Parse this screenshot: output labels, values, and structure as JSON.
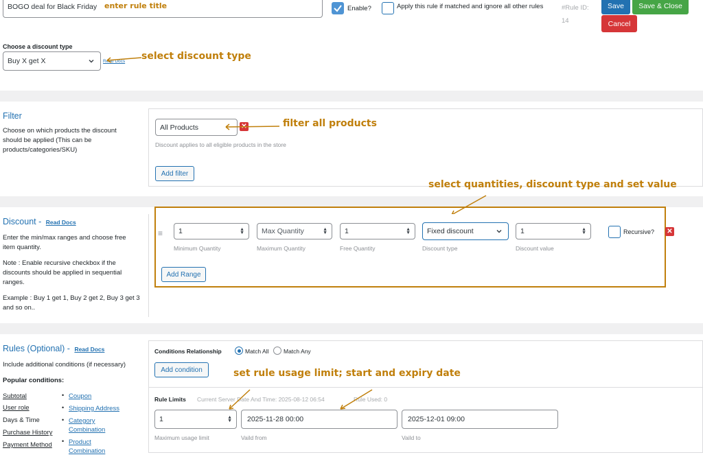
{
  "header": {
    "rule_title_value": "BOGO deal for Black Friday",
    "enable_label": "Enable?",
    "apply_rule_label": "Apply this rule if matched and ignore all other rules",
    "rule_id_label": "#Rule ID:",
    "rule_id_value": "14",
    "save_label": "Save",
    "save_close_label": "Save & Close",
    "cancel_label": "Cancel"
  },
  "discount_type": {
    "label": "Choose a discount type",
    "selected": "Buy X get X",
    "read_docs": "Read Docs"
  },
  "filter": {
    "title": "Filter",
    "description": "Choose on which products the discount should be applied (This can be products/categories/SKU)",
    "selected": "All Products",
    "hint": "Discount applies to all eligible products in the store",
    "add_filter_label": "Add filter"
  },
  "discount": {
    "title": "Discount -",
    "read_docs": "Read Docs",
    "desc1": "Enter the min/max ranges and choose free item quantity.",
    "desc2": "Note : Enable recursive checkbox if the discounts should be applied in sequential ranges.",
    "desc3": "Example : Buy 1 get 1, Buy 2 get 2, Buy 3 get 3 and so on..",
    "min_qty_value": "1",
    "min_qty_hint": "Minimum Quantity",
    "max_qty_placeholder": "Max Quantity",
    "max_qty_hint": "Maximum Quantity",
    "free_qty_value": "1",
    "free_qty_hint": "Free Quantity",
    "discount_type_selected": "Fixed discount",
    "discount_type_hint": "Discount type",
    "discount_value": "1",
    "discount_value_hint": "Discount value",
    "recursive_label": "Recursive?",
    "add_range_label": "Add Range"
  },
  "rules": {
    "title": "Rules (Optional) -",
    "read_docs": "Read Docs",
    "desc": "Include additional conditions (if necessary)",
    "popular_label": "Popular conditions:",
    "popular_left": [
      "Subtotal",
      "User role",
      "Days & Time",
      "Purchase History",
      "Payment Method"
    ],
    "popular_right": [
      "Coupon",
      "Shipping Address",
      "Category Combination",
      "Product Combination"
    ],
    "conditions_relationship_label": "Conditions Relationship",
    "match_all_label": "Match All",
    "match_any_label": "Match Any",
    "add_condition_label": "Add condition",
    "rule_limits_label": "Rule Limits",
    "server_date_label": "Current Server Date And Time: 2025-08-12 06:54",
    "rule_used_label": "Rule Used: 0",
    "max_usage_value": "1",
    "max_usage_hint": "Maximum usage limit",
    "valid_from_value": "2025-11-28 00:00",
    "valid_from_hint": "Vaild from",
    "valid_to_value": "2025-12-01 09:00",
    "valid_to_hint": "Vaild to"
  },
  "annotations": {
    "title": "enter rule title",
    "discount_type": "select discount type",
    "filter": "filter all products",
    "quantities": "select quantities, discount type and set value",
    "limits": "set rule usage limit; start and expiry date"
  },
  "colors": {
    "accent": "#2271b1",
    "save": "#2271b1",
    "save_close": "#46a546",
    "cancel": "#d63638",
    "annotation": "#c07f0b"
  }
}
